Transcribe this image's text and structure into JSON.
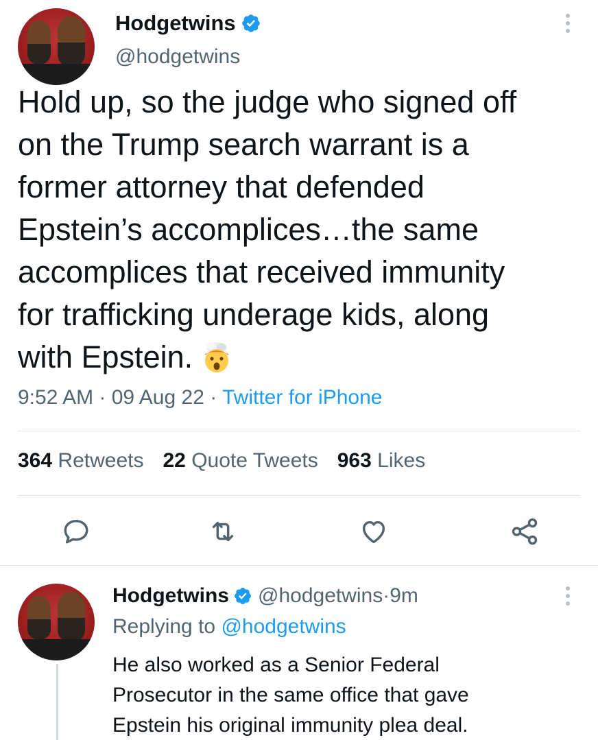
{
  "tweet": {
    "display_name": "Hodgetwins",
    "handle": "@hodgetwins",
    "text_lines": [
      "Hold up, so the judge who signed off",
      "on the Trump search warrant is a",
      "former attorney that defended",
      "Epstein’s accomplices…the same",
      "accomplices that received immunity",
      "for trafficking underage kids, along",
      "with Epstein."
    ],
    "emoji": "exploding-head-emoji",
    "time": "9:52 AM",
    "date": "09 Aug 22",
    "separator": " · ",
    "source": "Twitter for iPhone",
    "stats": {
      "retweets_count": "364",
      "retweets_label": "Retweets",
      "quotes_count": "22",
      "quotes_label": "Quote Tweets",
      "likes_count": "963",
      "likes_label": "Likes"
    },
    "action_icons": [
      "reply-icon",
      "retweet-icon",
      "like-icon",
      "share-icon"
    ]
  },
  "reply": {
    "display_name": "Hodgetwins",
    "handle": "@hodgetwins",
    "separator": " · ",
    "time_ago": "9m",
    "replying_prefix": "Replying to ",
    "replying_to": "@hodgetwins",
    "text_lines": [
      "He also worked as a Senior Federal",
      "Prosecutor in the same office that gave",
      "Epstein his original immunity plea deal."
    ]
  },
  "colors": {
    "text": "#0f1419",
    "secondary": "#536471",
    "link": "#1d9bf0",
    "verified": "#1d9bf0",
    "divider": "#e1e6ea"
  }
}
